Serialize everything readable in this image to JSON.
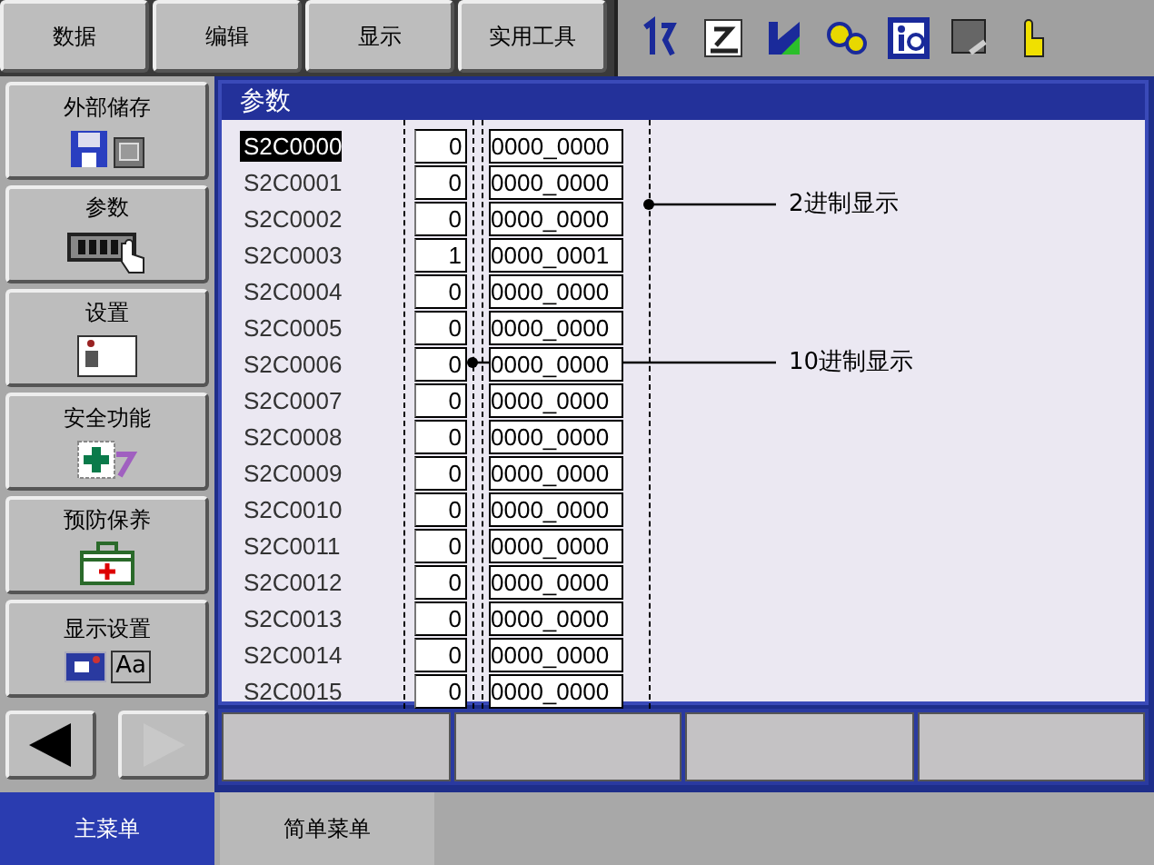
{
  "menu": [
    {
      "label": "数据"
    },
    {
      "label": "编辑"
    },
    {
      "label": "显示"
    },
    {
      "label": "实用工具"
    }
  ],
  "sidebar": {
    "items": [
      {
        "label": "外部储存",
        "kind": "storage"
      },
      {
        "label": "参数",
        "kind": "parameter"
      },
      {
        "label": "设置",
        "kind": "setup"
      },
      {
        "label": "安全功能",
        "kind": "safety"
      },
      {
        "label": "预防保养",
        "kind": "maintenance"
      },
      {
        "label": "显示设置",
        "kind": "display",
        "icon_text": "Aa"
      }
    ],
    "back_disabled": false,
    "forward_disabled": true
  },
  "panel": {
    "title": "参数",
    "rows": [
      {
        "name": "S2C0000",
        "decimal": "0",
        "binary": "0000_0000",
        "selected": true
      },
      {
        "name": "S2C0001",
        "decimal": "0",
        "binary": "0000_0000",
        "selected": false
      },
      {
        "name": "S2C0002",
        "decimal": "0",
        "binary": "0000_0000",
        "selected": false
      },
      {
        "name": "S2C0003",
        "decimal": "1",
        "binary": "0000_0001",
        "selected": false
      },
      {
        "name": "S2C0004",
        "decimal": "0",
        "binary": "0000_0000",
        "selected": false
      },
      {
        "name": "S2C0005",
        "decimal": "0",
        "binary": "0000_0000",
        "selected": false
      },
      {
        "name": "S2C0006",
        "decimal": "0",
        "binary": "0000_0000",
        "selected": false
      },
      {
        "name": "S2C0007",
        "decimal": "0",
        "binary": "0000_0000",
        "selected": false
      },
      {
        "name": "S2C0008",
        "decimal": "0",
        "binary": "0000_0000",
        "selected": false
      },
      {
        "name": "S2C0009",
        "decimal": "0",
        "binary": "0000_0000",
        "selected": false
      },
      {
        "name": "S2C0010",
        "decimal": "0",
        "binary": "0000_0000",
        "selected": false
      },
      {
        "name": "S2C0011",
        "decimal": "0",
        "binary": "0000_0000",
        "selected": false
      },
      {
        "name": "S2C0012",
        "decimal": "0",
        "binary": "0000_0000",
        "selected": false
      },
      {
        "name": "S2C0013",
        "decimal": "0",
        "binary": "0000_0000",
        "selected": false
      },
      {
        "name": "S2C0014",
        "decimal": "0",
        "binary": "0000_0000",
        "selected": false
      },
      {
        "name": "S2C0015",
        "decimal": "0",
        "binary": "0000_0000",
        "selected": false
      }
    ],
    "annotations": [
      {
        "label": "2进制显示"
      },
      {
        "label": "10进制显示"
      }
    ]
  },
  "bottom_tabs": [
    {
      "label": "主菜单",
      "selected": true
    },
    {
      "label": "简单菜单",
      "selected": false
    }
  ]
}
